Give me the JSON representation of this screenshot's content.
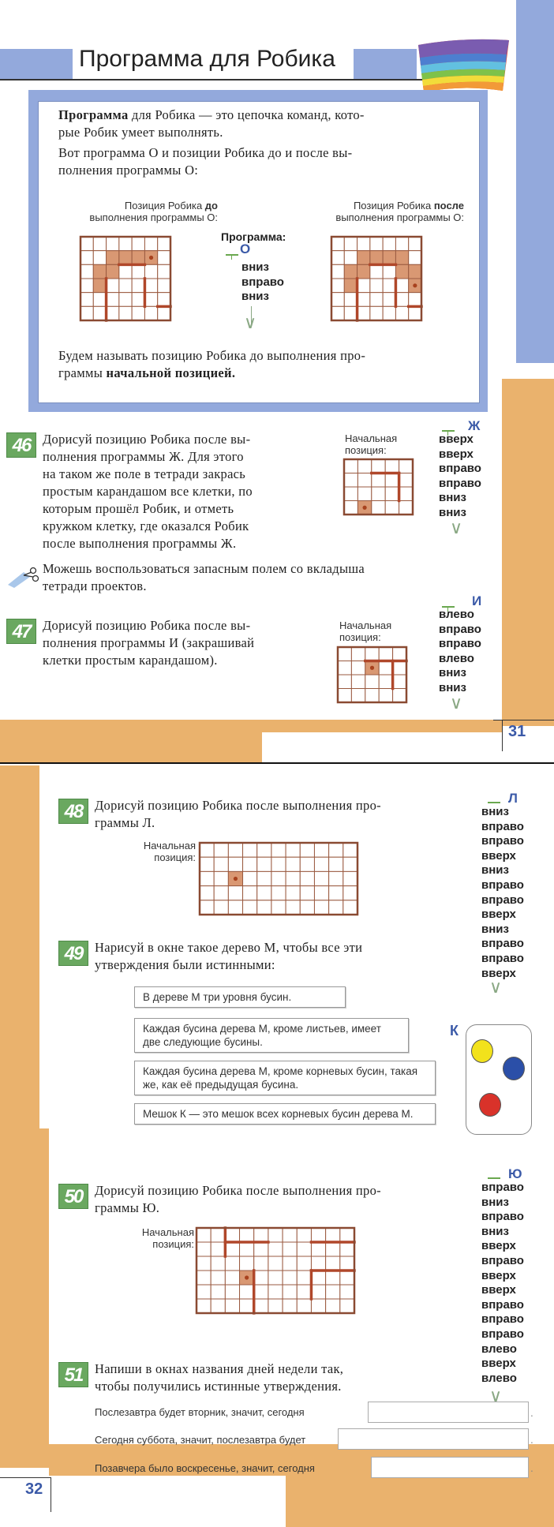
{
  "page1": {
    "title": "Программа для Робика",
    "page_number": "31",
    "definition": {
      "line1_bold": "Программа",
      "line1_rest": " для Робика — это цепочка команд, кото-",
      "line2": "рые Робик умеет выполнять.",
      "line3": "Вот программа О и позиции Робика до и после вы-",
      "line4": "полнения программы О:",
      "before_label_1": "Позиция Робика ",
      "before_label_bold": "до",
      "before_label_2": "выполнения программы О:",
      "after_label_1": "Позиция Робика ",
      "after_label_bold": "после",
      "after_label_2": "выполнения программы О:",
      "program_heading": "Программа:",
      "program_name": "О",
      "program_commands": [
        "вниз",
        "вправо",
        "вниз"
      ],
      "closing_1": "Будем называть позицию Робика до выполнения про-",
      "closing_2": "граммы ",
      "closing_bold": "начальной позицией."
    },
    "task46": {
      "number": "46",
      "lines": [
        "Дорисуй позицию Робика после вы-",
        "полнения программы Ж. Для этого",
        "на таком же поле в тетради закрась",
        "простым карандашом все клетки, по",
        "которым прошёл Робик, и отметь",
        "кружком клетку, где оказался Робик",
        "после выполнения программы Ж."
      ],
      "start_label_1": "Начальная",
      "start_label_2": "позиция:",
      "program_name": "Ж",
      "program_commands": [
        "вверх",
        "вверх",
        "вправо",
        "вправо",
        "вниз",
        "вниз"
      ]
    },
    "note": {
      "icon": "scissors-icon",
      "line1": "Можешь воспользоваться запасным полем со вкладыша",
      "line2": "тетради проектов."
    },
    "task47": {
      "number": "47",
      "lines": [
        "Дорисуй позицию Робика после вы-",
        "полнения программы И (закрашивай",
        "клетки простым карандашом)."
      ],
      "start_label_1": "Начальная",
      "start_label_2": "позиция:",
      "program_name": "И",
      "program_commands": [
        "влево",
        "вправо",
        "вправо",
        "влево",
        "вниз",
        "вниз"
      ]
    }
  },
  "page2": {
    "page_number": "32",
    "task48": {
      "number": "48",
      "line1": "Дорисуй позицию Робика после выполнения про-",
      "line2": "граммы Л.",
      "start_label_1": "Начальная",
      "start_label_2": "позиция:",
      "program_name": "Л",
      "program_commands": [
        "вниз",
        "вправо",
        "вправо",
        "вверх",
        "вниз",
        "вправо",
        "вправо",
        "вверх",
        "вниз",
        "вправо",
        "вправо",
        "вверх"
      ]
    },
    "task49": {
      "number": "49",
      "line1": "Нарисуй в окне такое дерево М, чтобы все эти",
      "line2": "утверждения были истинными:",
      "statements": [
        "В дереве М три уровня бусин.",
        "Каждая бусина дерева М, кроме листьев, имеет две следующие бусины.",
        "Каждая бусина дерева М, кроме корневых бусин, такая же, как её предыдущая бусина.",
        "Мешок К — это мешок всех корневых бусин дерева М."
      ],
      "bag_label": "К",
      "bag_beads": [
        {
          "color_name": "yellow",
          "color": "#f2e21c"
        },
        {
          "color_name": "blue",
          "color": "#2b4fa8"
        },
        {
          "color_name": "red",
          "color": "#d9322a"
        }
      ]
    },
    "task50": {
      "number": "50",
      "line1": "Дорисуй позицию Робика после выполнения про-",
      "line2": "граммы Ю.",
      "start_label_1": "Начальная",
      "start_label_2": "позиция:",
      "program_name": "Ю",
      "program_commands": [
        "вправо",
        "вниз",
        "вправо",
        "вниз",
        "вверх",
        "вправо",
        "вверх",
        "вверх",
        "вправо",
        "вправо",
        "вправо",
        "влево",
        "вверх",
        "влево"
      ]
    },
    "task51": {
      "number": "51",
      "line1": "Напиши в окнах названия дней недели так,",
      "line2": "чтобы получились истинные утверждения.",
      "rows": [
        {
          "label": "Послезавтра будет вторник, значит, сегодня",
          "value": ""
        },
        {
          "label": "Сегодня суббота, значит, послезавтра будет",
          "value": ""
        },
        {
          "label": "Позавчера было воскресенье, значит, сегодня",
          "value": ""
        }
      ]
    }
  },
  "grids": {
    "o_before": {
      "cols": 7,
      "rows": 6,
      "filled": [
        [
          2,
          1
        ],
        [
          3,
          1
        ],
        [
          4,
          1
        ],
        [
          5,
          1
        ],
        [
          1,
          2
        ],
        [
          2,
          2
        ],
        [
          1,
          3
        ]
      ],
      "robot": [
        5,
        1
      ],
      "walls": [
        [
          3,
          2,
          5,
          2
        ],
        [
          2,
          3,
          2,
          6
        ],
        [
          5,
          3,
          5,
          5
        ],
        [
          6,
          5,
          7,
          5
        ]
      ]
    },
    "o_after": {
      "cols": 7,
      "rows": 6,
      "filled": [
        [
          2,
          1
        ],
        [
          3,
          1
        ],
        [
          4,
          1
        ],
        [
          5,
          1
        ],
        [
          1,
          2
        ],
        [
          2,
          2
        ],
        [
          1,
          3
        ],
        [
          5,
          2
        ],
        [
          6,
          2
        ],
        [
          6,
          3
        ]
      ],
      "robot": [
        6,
        3
      ],
      "walls": [
        [
          3,
          2,
          5,
          2
        ],
        [
          2,
          3,
          2,
          6
        ],
        [
          5,
          3,
          5,
          5
        ],
        [
          6,
          5,
          7,
          5
        ]
      ]
    },
    "zh": {
      "cols": 5,
      "rows": 4,
      "filled": [
        [
          1,
          3
        ]
      ],
      "robot": [
        1,
        3
      ],
      "walls": [
        [
          2,
          1,
          4,
          1
        ],
        [
          4,
          1,
          4,
          3
        ]
      ]
    },
    "i": {
      "cols": 5,
      "rows": 4,
      "filled": [
        [
          2,
          1
        ]
      ],
      "robot": [
        2,
        1
      ],
      "walls": [
        [
          2,
          1,
          5,
          1
        ],
        [
          4,
          1,
          4,
          3
        ]
      ]
    },
    "l": {
      "cols": 11,
      "rows": 5,
      "filled": [
        [
          2,
          2
        ]
      ],
      "robot": [
        2,
        2
      ],
      "walls": []
    },
    "yu": {
      "cols": 11,
      "rows": 6,
      "filled": [
        [
          3,
          3
        ]
      ],
      "robot": [
        3,
        3
      ],
      "walls": [
        [
          2,
          0,
          2,
          2
        ],
        [
          2,
          1,
          5,
          1
        ],
        [
          8,
          1,
          11,
          1
        ],
        [
          4,
          3,
          4,
          6
        ],
        [
          8,
          3,
          8,
          5
        ],
        [
          8,
          3,
          11,
          3
        ]
      ]
    }
  }
}
